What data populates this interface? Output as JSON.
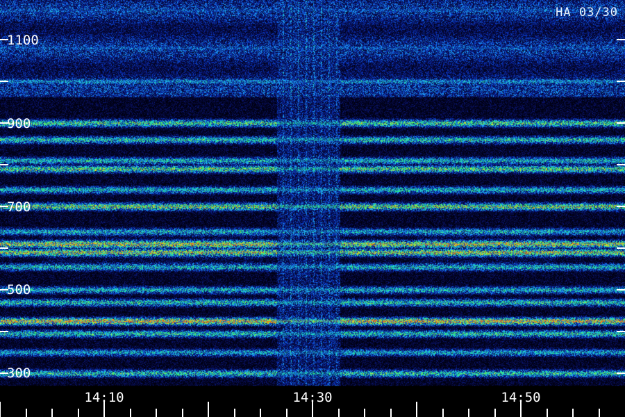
{
  "stamp": "HA 03/30",
  "chart_data": {
    "type": "heatmap",
    "title": "",
    "xlabel": "",
    "ylabel": "",
    "x_tick_labels": [
      "14:10",
      "14:30",
      "14:50"
    ],
    "y_tick_labels": [
      "1100",
      "900",
      "700",
      "500",
      "300"
    ],
    "y_ticks_unlabeled": [
      1000,
      800,
      600,
      400
    ],
    "ylim": [
      270,
      1280
    ],
    "colormap": [
      "#000010",
      "#0a1060",
      "#0838c8",
      "#20a0ff",
      "#20e0c0",
      "#30f060",
      "#f0f020",
      "#f06010"
    ],
    "bands": [
      {
        "y": 1270,
        "intensity": 0.45
      },
      {
        "y": 1170,
        "intensity": 0.35
      },
      {
        "y": 1080,
        "intensity": 0.35
      },
      {
        "y": 1000,
        "intensity": 0.45
      },
      {
        "y": 900,
        "intensity": 0.68
      },
      {
        "y": 860,
        "intensity": 0.6
      },
      {
        "y": 810,
        "intensity": 0.55
      },
      {
        "y": 790,
        "intensity": 0.7
      },
      {
        "y": 740,
        "intensity": 0.55
      },
      {
        "y": 700,
        "intensity": 0.75
      },
      {
        "y": 640,
        "intensity": 0.5
      },
      {
        "y": 610,
        "intensity": 0.82
      },
      {
        "y": 590,
        "intensity": 0.78
      },
      {
        "y": 555,
        "intensity": 0.55
      },
      {
        "y": 500,
        "intensity": 0.55
      },
      {
        "y": 470,
        "intensity": 0.6
      },
      {
        "y": 425,
        "intensity": 0.9
      },
      {
        "y": 395,
        "intensity": 0.6
      },
      {
        "y": 350,
        "intensity": 0.5
      },
      {
        "y": 300,
        "intensity": 0.62
      }
    ]
  }
}
